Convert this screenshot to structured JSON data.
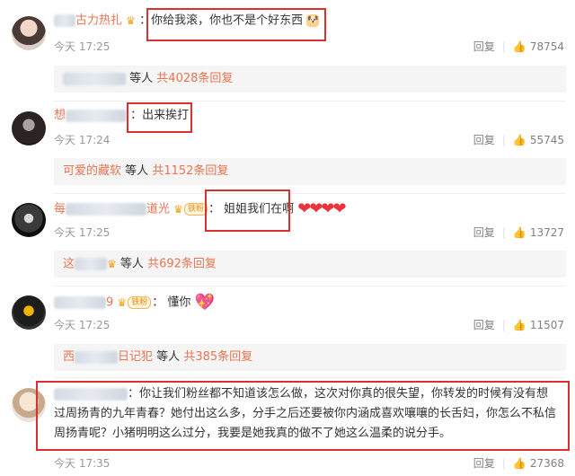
{
  "comments": [
    {
      "name_visible": "古力热扎",
      "text": "你给我滚，你也不是个好东西",
      "time": "今天 17:25",
      "reply_label": "回复",
      "likes": "78754",
      "replies_prefix": "等人",
      "replies_count": "共4028条回复"
    },
    {
      "name_visible": "想",
      "text": "出来挨打",
      "time": "今天 17:24",
      "reply_label": "回复",
      "likes": "55745",
      "reply_user": "可爱的藏软",
      "replies_prefix": "等人",
      "replies_count": "共1152条回复"
    },
    {
      "name_visible": "每",
      "name_tail": "道光",
      "badge": "铁粉",
      "text": "姐姐我们在啊",
      "time": "今天 17:25",
      "reply_label": "回复",
      "likes": "13727",
      "reply_user": "这",
      "replies_prefix": "等人",
      "replies_count": "共692条回复"
    },
    {
      "name_tail": "9",
      "badge": "铁粉",
      "text": "懂你",
      "time": "今天 17:25",
      "reply_label": "回复",
      "likes": "11507",
      "reply_user": "西",
      "reply_user_tail": "日记犯",
      "replies_prefix": "等人",
      "replies_count": "共385条回复"
    },
    {
      "text": "你让我们粉丝都不知道该怎么做，这次对你真的很失望，你转发的时候有没有想过周扬青的九年青春？她付出这么多，分手之后还要被你内涵成喜欢嚷嚷的长舌妇，你怎么不私信周扬青呢？小猪明明这么过分，我要是她我真的做不了她这么温柔的说分手。",
      "line1": "你让我们粉丝都不知道该怎么做，这次对你真的很失望，你转发的时候有没有想",
      "line2": "过周扬青的九年青春？她付出这么多，分手之后还要被你内涵成喜欢嚷嚷的长舌妇，你怎么不私信",
      "line3": "周扬青呢？小猪明明这么过分，我要是她我真的做不了她这么温柔的说分手。",
      "time": "今天 17:35",
      "reply_label": "回复",
      "likes": "27368"
    }
  ],
  "colors": {
    "link": "#eb7350",
    "highlight": "#d93030",
    "meta": "#999999"
  },
  "icons": {
    "like": "thumbs-up-icon",
    "crown": "crown-icon",
    "heart": "heart-emoji"
  }
}
